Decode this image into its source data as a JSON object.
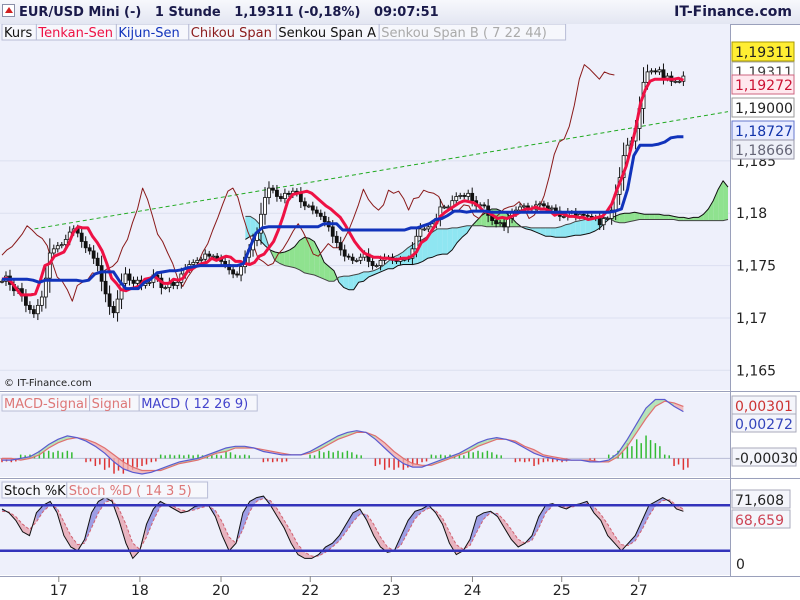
{
  "header": {
    "instrument": "EUR/USD Mini (-)",
    "interval": "1 Stunde",
    "price": "1,19311 (-0,18%)",
    "time": "09:07:51",
    "site": "IT-Finance.com"
  },
  "copyright": "© IT-Finance.com",
  "colors": {
    "price_candles": "#111111",
    "tenkan": "#ee1144",
    "kijun": "#1133bb",
    "chikou": "#8a1a1a",
    "senkou_a": "#111111",
    "senkou_b": "#444444",
    "cloud_bull": "#8fe28f",
    "cloud_bear": "#8fe6f2",
    "trendline": "#22aa22",
    "macd_signal": "#e07070",
    "macd": "#5a5ad0",
    "macd_hist_pos": "#33bb33",
    "macd_hist_neg": "#dd3333",
    "stoch_k": "#111111",
    "stoch_d": "#d06070",
    "stoch_band": "#3333bb",
    "panel_bg": "#eef0fb"
  },
  "chart_data": [
    {
      "type": "candlestick",
      "panel": "price",
      "legend": [
        "Kurs",
        "Tenkan-Sen",
        "Kijun-Sen",
        "Chikou Span",
        "Senkou Span A",
        "Senkou Span B ( 7 22 44)"
      ],
      "y_ticks": [
        "1,165",
        "1,17",
        "1,175",
        "1,18",
        "1,185"
      ],
      "ylim": [
        1.1635,
        1.1975
      ],
      "price_tags": [
        "1,19311",
        "1,19311",
        "1,19272",
        "1,19000",
        "1,18727",
        "1,18666"
      ],
      "x_ticks": [
        "17",
        "18",
        "20",
        "22",
        "23",
        "24",
        "25",
        "27"
      ],
      "x_domain": [
        0,
        179
      ],
      "x_tick_positions": [
        14,
        34,
        54,
        76,
        96,
        116,
        138,
        157
      ],
      "kurs": [
        1.1735,
        1.174,
        1.1732,
        1.1726,
        1.1728,
        1.1721,
        1.1712,
        1.1708,
        1.1704,
        1.1712,
        1.172,
        1.1738,
        1.1762,
        1.1766,
        1.1769,
        1.177,
        1.1775,
        1.1782,
        1.1785,
        1.1781,
        1.1773,
        1.1767,
        1.1764,
        1.1757,
        1.175,
        1.1735,
        1.1723,
        1.1711,
        1.1705,
        1.1718,
        1.1733,
        1.1742,
        1.1736,
        1.1733,
        1.1736,
        1.1731,
        1.1733,
        1.1734,
        1.1741,
        1.1738,
        1.1729,
        1.1729,
        1.1734,
        1.1731,
        1.1734,
        1.1742,
        1.1747,
        1.1751,
        1.1753,
        1.1755,
        1.1756,
        1.1761,
        1.1759,
        1.1759,
        1.1757,
        1.1754,
        1.1751,
        1.1746,
        1.1742,
        1.1741,
        1.1749,
        1.1758,
        1.1765,
        1.1774,
        1.1781,
        1.1799,
        1.1815,
        1.1824,
        1.1822,
        1.1816,
        1.1814,
        1.1819,
        1.1818,
        1.1821,
        1.1819,
        1.1811,
        1.1807,
        1.1807,
        1.1803,
        1.18,
        1.1797,
        1.1792,
        1.1787,
        1.1778,
        1.1772,
        1.1765,
        1.1759,
        1.1758,
        1.1755,
        1.1755,
        1.1758,
        1.1761,
        1.1754,
        1.175,
        1.175,
        1.1755,
        1.1758,
        1.1758,
        1.1755,
        1.1754,
        1.1756,
        1.1756,
        1.1757,
        1.1766,
        1.1778,
        1.1785,
        1.1785,
        1.1787,
        1.179,
        1.1795,
        1.1806,
        1.1806,
        1.1806,
        1.1812,
        1.1816,
        1.1817,
        1.1816,
        1.1819,
        1.1812,
        1.1807,
        1.1808,
        1.1807,
        1.1798,
        1.1793,
        1.179,
        1.1791,
        1.1787,
        1.1795,
        1.18,
        1.1803,
        1.1806,
        1.1807,
        1.1805,
        1.1804,
        1.1808,
        1.1809,
        1.1807,
        1.1804,
        1.1805,
        1.1802,
        1.1797,
        1.1797,
        1.1801,
        1.1801,
        1.1797,
        1.1799,
        1.1798,
        1.1797,
        1.1796,
        1.1795,
        1.1789,
        1.1795,
        1.1795,
        1.1803,
        1.1818,
        1.1834,
        1.1855,
        1.1865,
        1.1869,
        1.1881,
        1.19,
        1.1925,
        1.1935,
        1.1936,
        1.1935,
        1.1937,
        1.1929,
        1.1931,
        1.1926,
        1.1926,
        1.1926,
        1.1931
      ],
      "tenkan": [
        1.1737,
        1.1738,
        1.1734,
        1.1728,
        1.1722,
        1.1722,
        1.1722,
        1.1723,
        1.1735,
        1.175,
        1.1752,
        1.1759,
        1.1761,
        1.1763,
        1.1771,
        1.1782,
        1.1787,
        1.1786,
        1.1786,
        1.1778,
        1.1772,
        1.1764,
        1.1752,
        1.1738,
        1.1733,
        1.1727,
        1.1726,
        1.1728,
        1.1729,
        1.1731,
        1.1737,
        1.1738,
        1.174,
        1.1736,
        1.1733,
        1.1733,
        1.1737,
        1.1736,
        1.1738,
        1.1745,
        1.1747,
        1.175,
        1.1752,
        1.1753,
        1.1757,
        1.1755,
        1.1757,
        1.1759,
        1.1758,
        1.1754,
        1.1754,
        1.1752,
        1.1751,
        1.1753,
        1.1759,
        1.1761,
        1.1767,
        1.1773,
        1.1784,
        1.1797,
        1.1812,
        1.1818,
        1.1819,
        1.182,
        1.1821,
        1.1819,
        1.1815,
        1.1811,
        1.1807,
        1.1804,
        1.18,
        1.1796,
        1.1789,
        1.1781,
        1.1773,
        1.1767,
        1.1762,
        1.176,
        1.1758,
        1.1758,
        1.1757,
        1.1757,
        1.1756,
        1.1756,
        1.1757,
        1.1757,
        1.1759,
        1.1763,
        1.1772,
        1.1775,
        1.1782,
        1.1789,
        1.1797,
        1.1801,
        1.1804,
        1.1807,
        1.181,
        1.1812,
        1.1811,
        1.181,
        1.1807,
        1.1802,
        1.1801,
        1.1798,
        1.1795,
        1.1796,
        1.1795,
        1.1797,
        1.1799,
        1.1802,
        1.1804,
        1.1804,
        1.1806,
        1.1804,
        1.1804,
        1.1802,
        1.1798,
        1.18,
        1.1799,
        1.1797,
        1.1797,
        1.1796,
        1.1796,
        1.1794,
        1.1795,
        1.1796,
        1.1797,
        1.1802,
        1.1809,
        1.1822,
        1.1833,
        1.1845,
        1.1862,
        1.1881,
        1.1905,
        1.1918,
        1.1926,
        1.1928,
        1.1928,
        1.1928,
        1.1928,
        1.1928,
        1.1929,
        1.1927
      ],
      "tenkan_x_start": 0,
      "kijun": [
        1.1737,
        1.1737,
        1.1737,
        1.1737,
        1.1737,
        1.1736,
        1.1734,
        1.1736,
        1.1736,
        1.1736,
        1.1736,
        1.1736,
        1.1736,
        1.1735,
        1.1736,
        1.1742,
        1.1744,
        1.1744,
        1.1744,
        1.1735,
        1.1728,
        1.1728,
        1.1728,
        1.1734,
        1.1737,
        1.1743,
        1.1744,
        1.1745,
        1.1745,
        1.1746,
        1.1748,
        1.1749,
        1.175,
        1.175,
        1.175,
        1.175,
        1.175,
        1.175,
        1.175,
        1.1752,
        1.1767,
        1.1781,
        1.1786,
        1.1787,
        1.1787,
        1.1787,
        1.1787,
        1.1787,
        1.1787,
        1.1787,
        1.1787,
        1.1787,
        1.179,
        1.179,
        1.179,
        1.1784,
        1.1784,
        1.1784,
        1.1784,
        1.1784,
        1.1784,
        1.1784,
        1.1784,
        1.1784,
        1.1784,
        1.1784,
        1.1786,
        1.1786,
        1.1788,
        1.179,
        1.1794,
        1.1795,
        1.1798,
        1.1802,
        1.1802,
        1.1801,
        1.1802,
        1.1802,
        1.1802,
        1.1801,
        1.1801,
        1.1801,
        1.1801,
        1.1801,
        1.1801,
        1.1801,
        1.1801,
        1.1801,
        1.1801,
        1.1801,
        1.1801,
        1.1801,
        1.1801,
        1.1801,
        1.1801,
        1.1801,
        1.1801,
        1.1801,
        1.1801,
        1.1802,
        1.1804,
        1.1823,
        1.1855,
        1.1865,
        1.1865,
        1.1865,
        1.1866,
        1.1868,
        1.1872,
        1.1873,
        1.1873
      ],
      "kijun_x_start": 0,
      "chikou": [
        1.176,
        1.1765,
        1.1768,
        1.1774,
        1.178,
        1.1788,
        1.1784,
        1.1779,
        1.1776,
        1.1769,
        1.1753,
        1.1739,
        1.1735,
        1.1727,
        1.1716,
        1.1731,
        1.1734,
        1.1736,
        1.1743,
        1.1742,
        1.1744,
        1.1747,
        1.1749,
        1.1754,
        1.1767,
        1.1775,
        1.1791,
        1.1804,
        1.1824,
        1.1813,
        1.1797,
        1.178,
        1.1773,
        1.1762,
        1.1752,
        1.1738,
        1.173,
        1.1739,
        1.1746,
        1.1752,
        1.1763,
        1.1771,
        1.1784,
        1.1796,
        1.1809,
        1.1821,
        1.1824,
        1.1815,
        1.1797,
        1.1782,
        1.1771,
        1.1757,
        1.1754,
        1.175,
        1.1752,
        1.1761,
        1.1766,
        1.1774,
        1.1783,
        1.179,
        1.1782,
        1.1772,
        1.1761,
        1.1759,
        1.1765,
        1.1771,
        1.1767,
        1.1767,
        1.1774,
        1.1783,
        1.1795,
        1.1808,
        1.1823,
        1.1813,
        1.1807,
        1.1803,
        1.1808,
        1.1822,
        1.1819,
        1.1821,
        1.1814,
        1.1803,
        1.1814,
        1.1815,
        1.1822,
        1.182,
        1.1819,
        1.1816,
        1.1806,
        1.1805,
        1.1802,
        1.1803,
        1.1808,
        1.1807,
        1.1798,
        1.1795,
        1.1801,
        1.1802,
        1.1795,
        1.1799,
        1.1804,
        1.1806,
        1.1807,
        1.1811,
        1.1805,
        1.1795,
        1.1798,
        1.1805,
        1.1817,
        1.1835,
        1.1856,
        1.1868,
        1.1871,
        1.1883,
        1.1903,
        1.1928,
        1.1942,
        1.1938,
        1.1933,
        1.1928,
        1.1935,
        1.1933,
        1.1932
      ],
      "chikou_x_start": 0,
      "senkou_a": [
        1.1775,
        1.1778,
        1.1779,
        1.1774,
        1.1769,
        1.1765,
        1.1763,
        1.1762,
        1.1763,
        1.1765,
        1.1768,
        1.1774,
        1.1777,
        1.1776,
        1.1773,
        1.1764,
        1.1753,
        1.1749,
        1.1745,
        1.1734,
        1.1729,
        1.1727,
        1.1727,
        1.1734,
        1.1735,
        1.1739,
        1.1741,
        1.1743,
        1.1745,
        1.1747,
        1.1747,
        1.175,
        1.1751,
        1.1751,
        1.1751,
        1.1752,
        1.1754,
        1.1757,
        1.1758,
        1.176,
        1.1761,
        1.1761,
        1.1765,
        1.1772,
        1.1777,
        1.1781,
        1.1788,
        1.1793,
        1.1798,
        1.1801,
        1.1804,
        1.1804,
        1.1802,
        1.18,
        1.1796,
        1.1791,
        1.1787,
        1.1785,
        1.1784,
        1.1782,
        1.178,
        1.1778,
        1.1778,
        1.1777,
        1.1777,
        1.1777,
        1.1778,
        1.1779,
        1.1779,
        1.178,
        1.1781,
        1.1783,
        1.1786,
        1.1791,
        1.1795,
        1.1797,
        1.1799,
        1.18,
        1.18,
        1.1801,
        1.18,
        1.1799,
        1.1799,
        1.1799,
        1.1799,
        1.1798,
        1.1798,
        1.1797,
        1.1796,
        1.1796,
        1.1795,
        1.1796,
        1.1796,
        1.1799,
        1.1804,
        1.1812,
        1.1823,
        1.1831,
        1.1825
      ],
      "senkou_a_x_start": 0,
      "senkou_b": [
        1.1797,
        1.1797,
        1.1794,
        1.1789,
        1.1779,
        1.1765,
        1.1755,
        1.1752,
        1.175,
        1.1749,
        1.1748,
        1.1746,
        1.1743,
        1.1742,
        1.1741,
        1.1739,
        1.1737,
        1.1735,
        1.1735,
        1.1739,
        1.174,
        1.174,
        1.1741,
        1.1742,
        1.1744,
        1.1744,
        1.1745,
        1.1747,
        1.175,
        1.1754,
        1.1758,
        1.176,
        1.1763,
        1.1767,
        1.177,
        1.1773,
        1.1775,
        1.1778,
        1.1782,
        1.1785,
        1.1785,
        1.1785,
        1.1786,
        1.1786,
        1.1787,
        1.1788,
        1.1788,
        1.1788,
        1.1788,
        1.1787,
        1.1787,
        1.1787,
        1.1787,
        1.1787,
        1.1787,
        1.1787,
        1.1787,
        1.1787,
        1.1786,
        1.1786,
        1.1786,
        1.1786,
        1.1786,
        1.1786,
        1.1787,
        1.1789,
        1.179,
        1.1792,
        1.1793,
        1.1794,
        1.1795,
        1.1796,
        1.1796,
        1.1796,
        1.1795,
        1.1792,
        1.1791,
        1.1791,
        1.1792,
        1.1793,
        1.1794,
        1.1794,
        1.1794,
        1.1794,
        1.1794,
        1.1794,
        1.1794,
        1.1794,
        1.1793,
        1.1793,
        1.1793,
        1.1793,
        1.1793,
        1.1793,
        1.1793,
        1.1793,
        1.1793,
        1.1793,
        1.1794
      ],
      "senkou_b_x_start": 0,
      "trendline": [
        [
          8,
          1.1785
        ],
        [
          179,
          1.1897
        ]
      ]
    },
    {
      "type": "line",
      "panel": "macd",
      "legend": [
        "MACD-Signal",
        "Signal",
        "MACD ( 12 26 9)"
      ],
      "value_tags": [
        "0,00301",
        "0,00272",
        "-0,00030"
      ],
      "ylim": [
        -0.0009,
        0.0036
      ],
      "macd": [
        -0.0001,
        -0.0001,
        0.0,
        0.0001,
        0.0004,
        0.0008,
        0.0011,
        0.0013,
        0.0012,
        0.001,
        0.0007,
        0.0003,
        -0.0002,
        -0.0006,
        -0.0008,
        -0.0009,
        -0.0008,
        -0.0006,
        -0.0004,
        -0.0002,
        -0.0001,
        0.0,
        0.0002,
        0.0004,
        0.0006,
        0.0007,
        0.0007,
        0.0006,
        0.0004,
        0.0003,
        0.0002,
        0.0002,
        0.0002,
        0.0004,
        0.0007,
        0.001,
        0.0013,
        0.0015,
        0.0016,
        0.0015,
        0.0011,
        0.0006,
        0.0001,
        -0.0003,
        -0.0005,
        -0.0005,
        -0.0003,
        -0.0001,
        0.0001,
        0.0003,
        0.0006,
        0.0009,
        0.0011,
        0.0012,
        0.0011,
        0.0009,
        0.0006,
        0.0003,
        0.0001,
        0.0,
        -0.0001,
        -0.0001,
        -0.0001,
        -0.0002,
        -0.0002,
        -0.0001,
        0.0003,
        0.0011,
        0.002,
        0.0029,
        0.0034,
        0.0034,
        0.003,
        0.0027
      ],
      "signal": [
        0.0,
        0.0,
        -0.0001,
        0.0,
        0.0002,
        0.0006,
        0.0009,
        0.0011,
        0.0012,
        0.0011,
        0.0009,
        0.0006,
        0.0002,
        -0.0002,
        -0.0005,
        -0.0007,
        -0.0007,
        -0.0007,
        -0.0005,
        -0.0003,
        -0.0002,
        -0.0001,
        0.0001,
        0.0003,
        0.0004,
        0.0006,
        0.0006,
        0.0006,
        0.0005,
        0.0004,
        0.0003,
        0.0002,
        0.0002,
        0.0003,
        0.0005,
        0.0008,
        0.0011,
        0.0013,
        0.0015,
        0.0015,
        0.0013,
        0.0009,
        0.0004,
        0.0,
        -0.0003,
        -0.0004,
        -0.0004,
        -0.0002,
        0.0,
        0.0002,
        0.0004,
        0.0007,
        0.0009,
        0.0011,
        0.0011,
        0.001,
        0.0007,
        0.0005,
        0.0002,
        0.0001,
        0.0,
        -0.0001,
        -0.0001,
        -0.0001,
        -0.0002,
        -0.0002,
        0.0001,
        0.0007,
        0.0015,
        0.0023,
        0.003,
        0.0033,
        0.0032,
        0.003
      ]
    },
    {
      "type": "line",
      "panel": "stochastic",
      "legend": [
        "Stoch %K",
        "Stoch %D ( 14 3 5)"
      ],
      "value_tags": [
        "71,608",
        "68,659"
      ],
      "y_tick": "0",
      "bands": [
        80,
        20
      ],
      "ylim": [
        0,
        100
      ],
      "k": [
        75,
        70,
        60,
        45,
        40,
        70,
        80,
        85,
        70,
        40,
        25,
        20,
        35,
        70,
        85,
        90,
        85,
        60,
        30,
        10,
        20,
        55,
        75,
        85,
        80,
        75,
        70,
        72,
        78,
        80,
        80,
        65,
        40,
        20,
        30,
        70,
        85,
        90,
        92,
        80,
        65,
        50,
        30,
        15,
        10,
        10,
        15,
        25,
        30,
        40,
        55,
        70,
        75,
        60,
        40,
        25,
        18,
        20,
        40,
        60,
        72,
        75,
        80,
        70,
        55,
        30,
        15,
        20,
        35,
        65,
        70,
        72,
        65,
        50,
        35,
        25,
        30,
        40,
        65,
        80,
        82,
        78,
        75,
        80,
        82,
        85,
        70,
        60,
        40,
        30,
        20,
        30,
        40,
        60,
        80,
        85,
        90,
        85,
        75,
        72
      ],
      "d": [
        72,
        71,
        65,
        55,
        48,
        58,
        72,
        80,
        76,
        58,
        40,
        28,
        30,
        50,
        70,
        84,
        87,
        75,
        55,
        30,
        22,
        38,
        60,
        78,
        82,
        78,
        74,
        72,
        74,
        77,
        79,
        73,
        58,
        38,
        30,
        48,
        72,
        85,
        89,
        86,
        75,
        60,
        45,
        28,
        18,
        13,
        13,
        18,
        25,
        33,
        45,
        58,
        68,
        68,
        55,
        38,
        25,
        20,
        28,
        45,
        62,
        71,
        76,
        73,
        63,
        45,
        28,
        22,
        27,
        45,
        62,
        70,
        69,
        60,
        48,
        35,
        30,
        34,
        50,
        70,
        79,
        80,
        77,
        78,
        80,
        82,
        78,
        68,
        55,
        40,
        28,
        27,
        33,
        48,
        66,
        80,
        86,
        87,
        80,
        75
      ]
    }
  ]
}
